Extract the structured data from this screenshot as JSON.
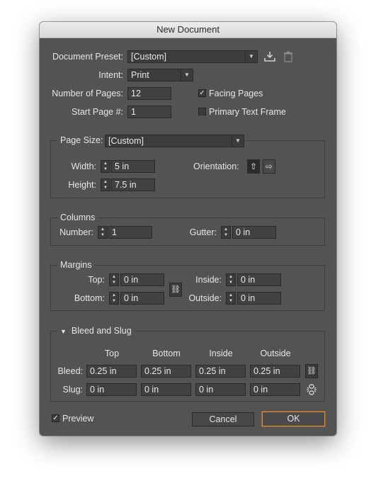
{
  "window": {
    "title": "New Document"
  },
  "doc": {
    "preset_label": "Document Preset:",
    "preset_value": "[Custom]",
    "intent_label": "Intent:",
    "intent_value": "Print",
    "pages_label": "Number of Pages:",
    "pages_value": "12",
    "start_label": "Start Page #:",
    "start_value": "1",
    "facing_label": "Facing Pages",
    "facing_checked": true,
    "primary_label": "Primary Text Frame",
    "primary_checked": false
  },
  "page_size": {
    "label": "Page Size:",
    "value": "[Custom]",
    "width_label": "Width:",
    "width_value": "5 in",
    "height_label": "Height:",
    "height_value": "7.5 in",
    "orientation_label": "Orientation:"
  },
  "columns": {
    "legend": "Columns",
    "number_label": "Number:",
    "number_value": "1",
    "gutter_label": "Gutter:",
    "gutter_value": "0 in"
  },
  "margins": {
    "legend": "Margins",
    "top_label": "Top:",
    "top_value": "0 in",
    "bottom_label": "Bottom:",
    "bottom_value": "0 in",
    "inside_label": "Inside:",
    "inside_value": "0 in",
    "outside_label": "Outside:",
    "outside_value": "0 in"
  },
  "bleed": {
    "legend": "Bleed and Slug",
    "headers": [
      "Top",
      "Bottom",
      "Inside",
      "Outside"
    ],
    "bleed_label": "Bleed:",
    "bleed_values": [
      "0.25 in",
      "0.25 in",
      "0.25 in",
      "0.25 in"
    ],
    "slug_label": "Slug:",
    "slug_values": [
      "0 in",
      "0 in",
      "0 in",
      "0 in"
    ]
  },
  "footer": {
    "preview_label": "Preview",
    "preview_checked": true,
    "cancel_label": "Cancel",
    "ok_label": "OK"
  },
  "colors": {
    "panel": "#535353",
    "field": "#414141",
    "accent": "#e4892a"
  }
}
